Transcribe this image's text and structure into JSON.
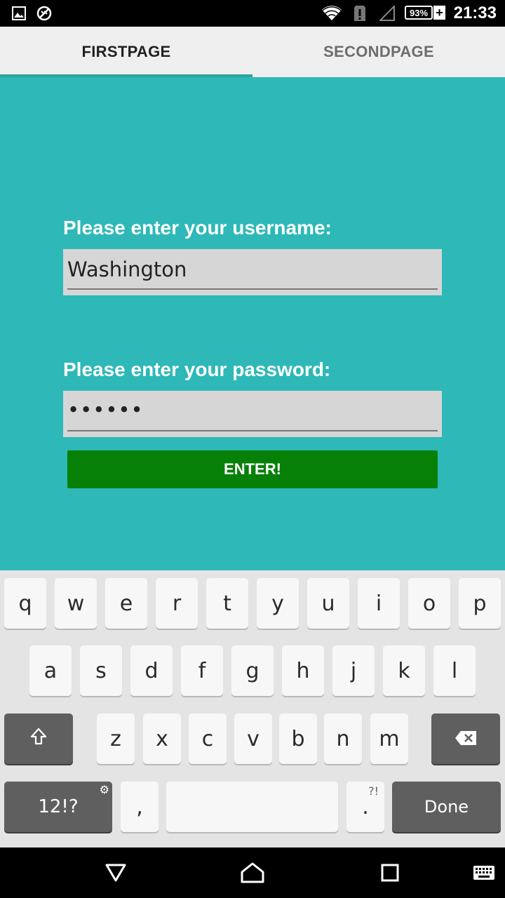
{
  "status_bar": {
    "time": "21:33",
    "battery": "93%",
    "battery_plus": "+",
    "icons": [
      "gallery-icon",
      "sync-disabled-icon",
      "wifi-icon",
      "alert-icon",
      "signal-icon",
      "battery-icon"
    ]
  },
  "tabs": [
    {
      "label": "FIRSTPAGE",
      "selected": true
    },
    {
      "label": "SECONDPAGE",
      "selected": false
    }
  ],
  "form": {
    "username_label": "Please enter your username:",
    "username_value": "Washington",
    "password_label": "Please enter your password:",
    "password_value": "••••••",
    "enter_label": "ENTER!"
  },
  "keyboard": {
    "row1": [
      "q",
      "w",
      "e",
      "r",
      "t",
      "y",
      "u",
      "i",
      "o",
      "p"
    ],
    "row2": [
      "a",
      "s",
      "d",
      "f",
      "g",
      "h",
      "j",
      "k",
      "l"
    ],
    "row3": [
      "z",
      "x",
      "c",
      "v",
      "b",
      "n",
      "m"
    ],
    "symbols_label": "12!?",
    "comma": ",",
    "period": ".",
    "period_hint": "?!",
    "done_label": "Done"
  },
  "nav_bar": {
    "icons": [
      "back-icon",
      "home-icon",
      "recents-icon",
      "keyboard-switch-icon"
    ]
  },
  "colors": {
    "background": "#2eb8b8",
    "tab_indicator": "#2aa59f",
    "enter_button": "#078007",
    "field": "#d6d6d6"
  }
}
